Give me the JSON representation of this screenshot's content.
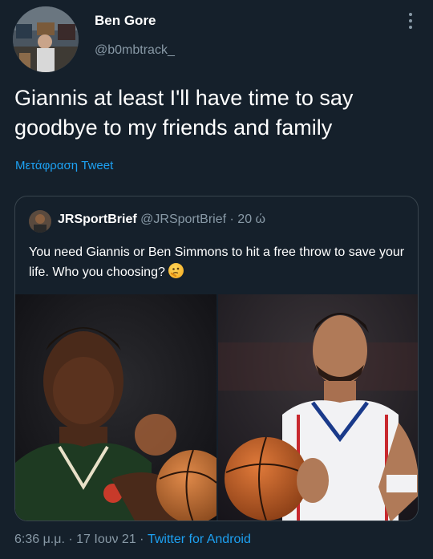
{
  "author": {
    "display_name": "Ben Gore",
    "handle": "@b0mbtrack_",
    "avatar": "profile-photo"
  },
  "tweet": {
    "text": "Giannis at least I'll have time to say goodbye to my friends and family",
    "translate_label": "Μετάφραση Tweet"
  },
  "quoted_tweet": {
    "display_name": "JRSportBrief",
    "handle": "@JRSportBrief",
    "separator": " · ",
    "time": "20 ώ",
    "text": "You need Giannis or Ben Simmons to hit a free throw to save your life. Who you choosing?",
    "emoji": "thinking-face",
    "images": [
      "giannis-free-throw-photo",
      "ben-simmons-free-throw-photo"
    ]
  },
  "footer": {
    "time": "6:36 μ.μ.",
    "date": "17 Ιουν 21",
    "separator": " · ",
    "source": "Twitter for Android"
  },
  "colors": {
    "background": "#15202b",
    "accent": "#1da1f2",
    "secondary_text": "#8899a6",
    "border": "#38444d"
  }
}
